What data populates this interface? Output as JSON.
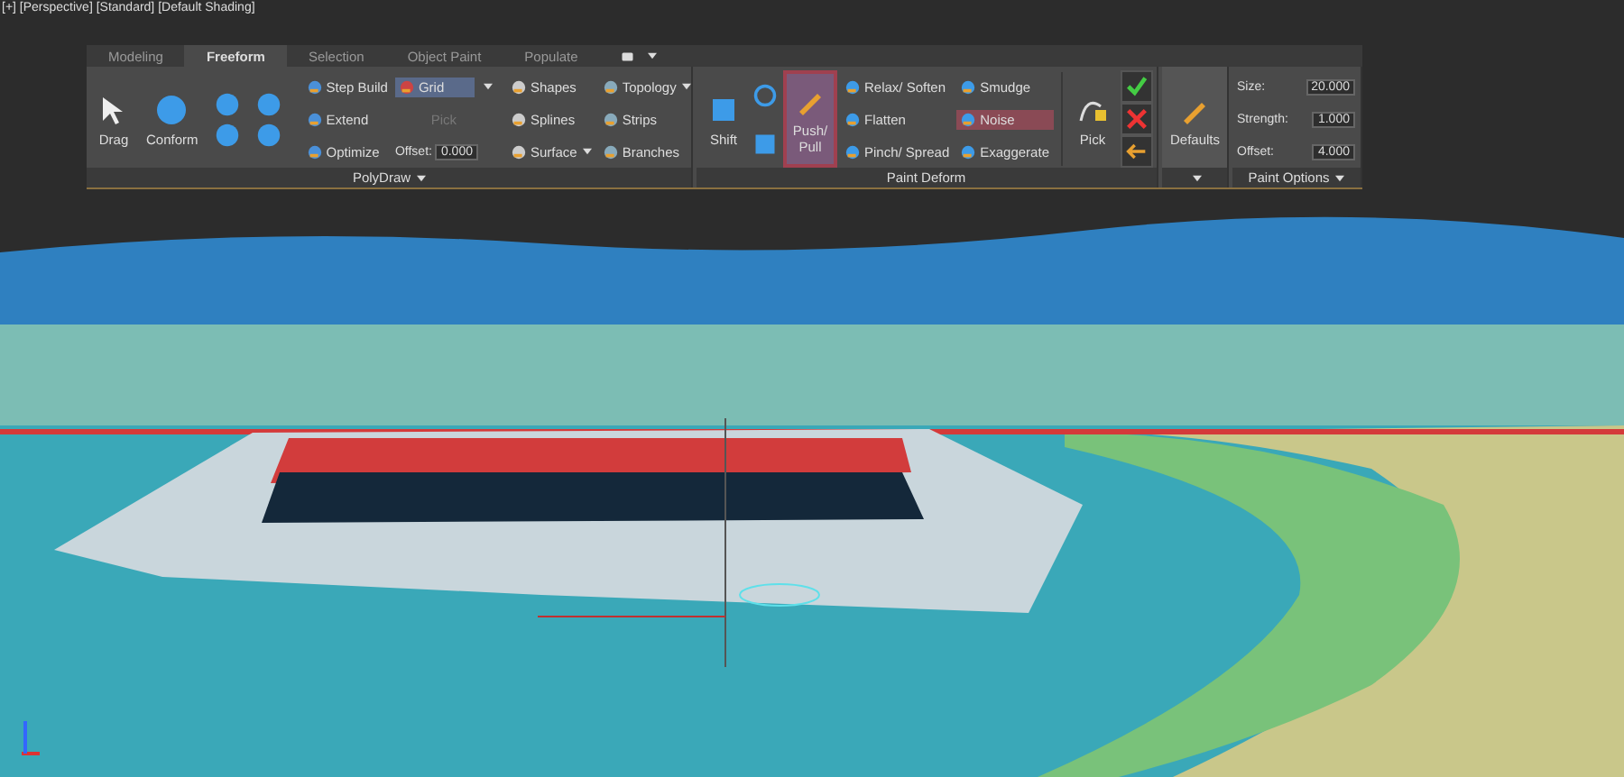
{
  "viewport_label": "[+] [Perspective] [Standard] [Default Shading]",
  "tabs": [
    {
      "label": "Modeling",
      "selected": false
    },
    {
      "label": "Freeform",
      "selected": true
    },
    {
      "label": "Selection",
      "selected": false
    },
    {
      "label": "Object Paint",
      "selected": false
    },
    {
      "label": "Populate",
      "selected": false
    }
  ],
  "polydraw": {
    "title": "PolyDraw",
    "drag": "Drag",
    "conform": "Conform",
    "build_tools": [
      "Step Build",
      "Extend",
      "Optimize"
    ],
    "grid": {
      "value": "Grid",
      "pick": "Pick",
      "pick_disabled": true,
      "offset_label": "Offset:",
      "offset_value": "0.000"
    },
    "shape_tools": [
      {
        "label": "Shapes",
        "menu": false
      },
      {
        "label": "Splines",
        "menu": false
      },
      {
        "label": "Surface",
        "menu": true
      }
    ],
    "topology_tools": [
      {
        "label": "Topology",
        "menu": true
      },
      {
        "label": "Strips",
        "menu": false
      },
      {
        "label": "Branches",
        "menu": false
      }
    ]
  },
  "paint_deform": {
    "title": "Paint Deform",
    "shift": "Shift",
    "push_pull": {
      "label": "Push/ Pull",
      "selected": true
    },
    "tools_a": [
      {
        "label": "Relax/ Soften",
        "selected": false
      },
      {
        "label": "Flatten",
        "selected": false
      },
      {
        "label": "Pinch/ Spread",
        "selected": false
      }
    ],
    "tools_b": [
      {
        "label": "Smudge",
        "selected": false
      },
      {
        "label": "Noise",
        "selected": true
      },
      {
        "label": "Exaggerate",
        "selected": false
      }
    ],
    "pick": "Pick"
  },
  "defaults": {
    "label": "Defaults"
  },
  "paint_options": {
    "title": "Paint Options",
    "fields": [
      {
        "label": "Size:",
        "value": "20.000"
      },
      {
        "label": "Strength:",
        "value": "1.000"
      },
      {
        "label": "Offset:",
        "value": "4.000"
      }
    ]
  }
}
